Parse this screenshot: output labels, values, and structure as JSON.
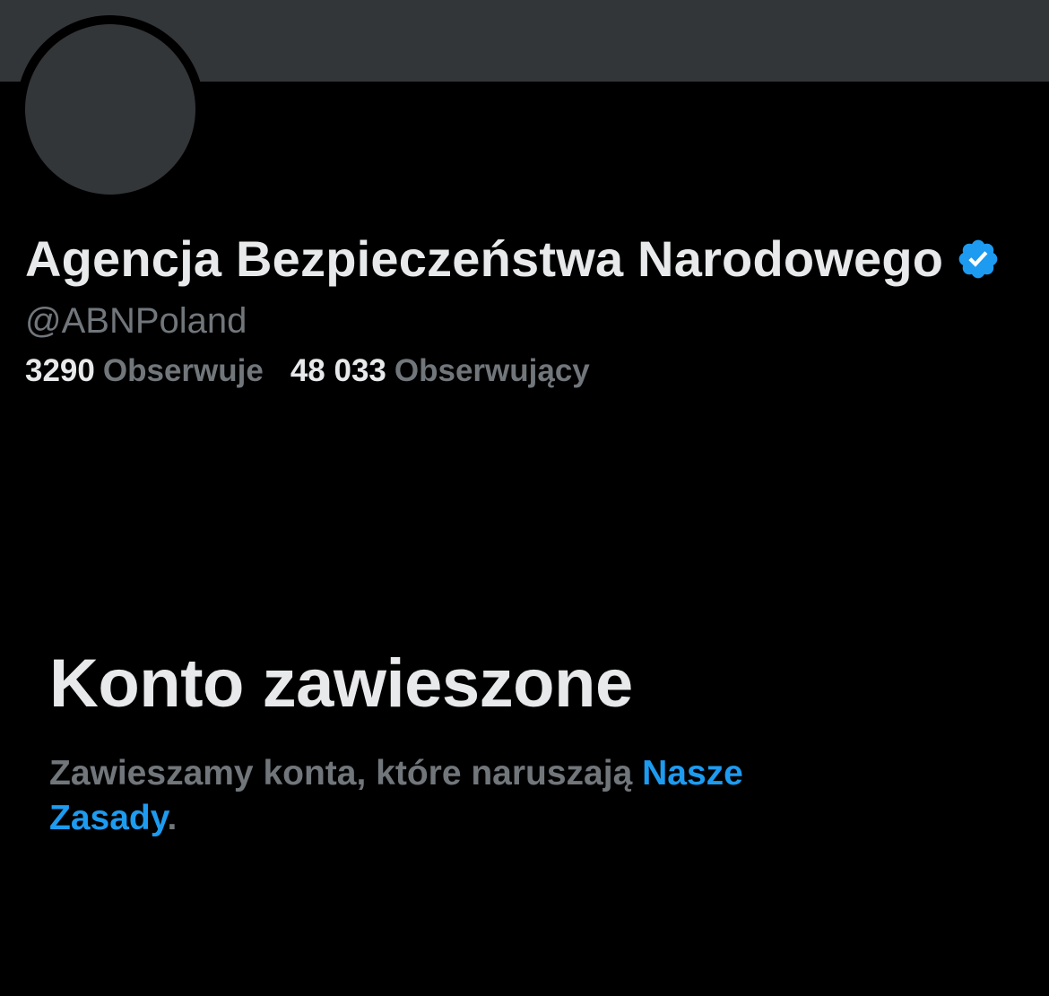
{
  "profile": {
    "display_name": "Agencja Bezpieczeństwa Narodowego",
    "verified_icon": "verified-badge-icon",
    "handle": "@ABNPoland",
    "following_count": "3290",
    "following_label": "Obserwuje",
    "followers_count": "48 033",
    "followers_label": "Obserwujący"
  },
  "suspension": {
    "title": "Konto zawieszone",
    "text": "Zawieszamy konta, które naruszają",
    "link_label": "Nasze Zasady",
    "period": "."
  },
  "colors": {
    "background": "#000000",
    "banner": "#333639",
    "primary_text": "#e7e9ea",
    "secondary_text": "#71767b",
    "accent": "#1d9bf0"
  }
}
